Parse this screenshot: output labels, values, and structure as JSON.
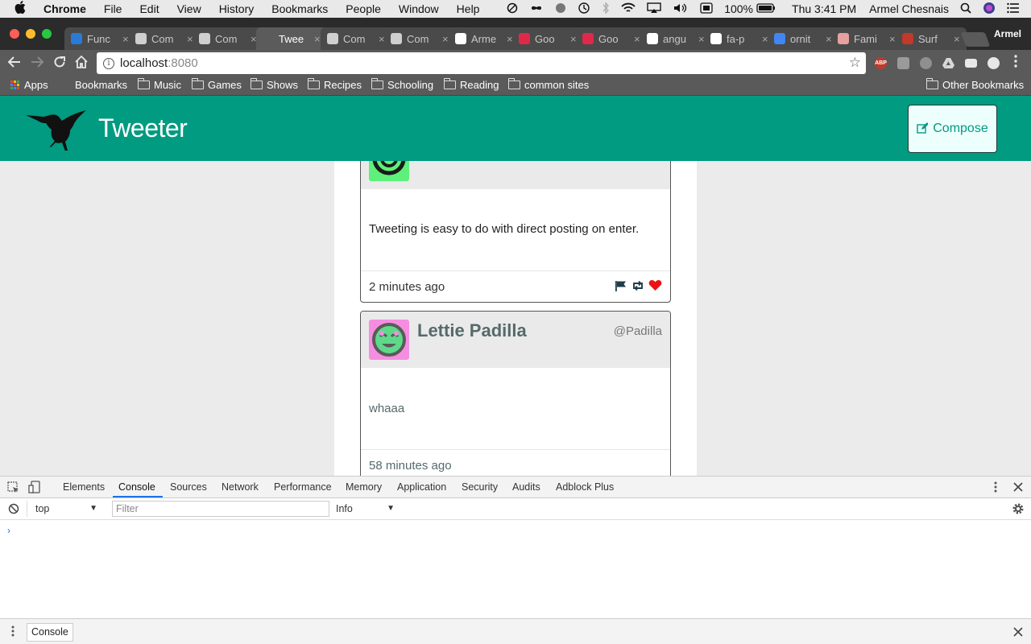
{
  "menubar": {
    "app": "Chrome",
    "items": [
      "File",
      "Edit",
      "View",
      "History",
      "Bookmarks",
      "People",
      "Window",
      "Help"
    ],
    "battery": "100%",
    "clock": "Thu 3:41 PM",
    "user": "Armel Chesnais"
  },
  "tabs": [
    {
      "label": "Func",
      "favicon": "book-icon",
      "color": "#2a7bd6"
    },
    {
      "label": "Com",
      "favicon": "globe-icon",
      "color": "#cfcfcf"
    },
    {
      "label": "Com",
      "favicon": "globe-icon",
      "color": "#cfcfcf"
    },
    {
      "label": "Twee",
      "favicon": "bird-icon",
      "color": "#5b5b5b",
      "active": true
    },
    {
      "label": "Com",
      "favicon": "globe-icon",
      "color": "#cfcfcf"
    },
    {
      "label": "Com",
      "favicon": "globe-icon",
      "color": "#cfcfcf"
    },
    {
      "label": "Arme",
      "favicon": "github-icon",
      "color": "#ffffff"
    },
    {
      "label": "Goo",
      "favicon": "m-icon",
      "color": "#e0294a"
    },
    {
      "label": "Goo",
      "favicon": "m-icon",
      "color": "#e0294a"
    },
    {
      "label": "angu",
      "favicon": "github-icon",
      "color": "#ffffff"
    },
    {
      "label": "fa-p",
      "favicon": "flag-icon",
      "color": "#ffffff"
    },
    {
      "label": "ornit",
      "favicon": "google-icon",
      "color": "#4285f4"
    },
    {
      "label": "Fami",
      "favicon": "image-icon",
      "color": "#e8a0a0"
    },
    {
      "label": "Surf",
      "favicon": "tv-icon",
      "color": "#c0392b"
    }
  ],
  "profile_name": "Armel",
  "address": {
    "host": "localhost",
    "port": ":8080"
  },
  "bookmarks": {
    "apps": "Apps",
    "items": [
      "Bookmarks",
      "Music",
      "Games",
      "Shows",
      "Recipes",
      "Schooling",
      "Reading",
      "common sites"
    ],
    "other": "Other Bookmarks"
  },
  "app": {
    "brand": "Tweeter",
    "compose_label": "Compose"
  },
  "tweets": [
    {
      "body": "Tweeting is easy to do with direct posting on enter.",
      "time": "2 minutes ago",
      "avatar_bg": "#5ef07a"
    },
    {
      "name": "Lettie Padilla",
      "handle": "@Padilla",
      "body": "whaaa",
      "time": "58 minutes ago",
      "avatar_bg": "#f58ee0"
    }
  ],
  "devtools": {
    "tabs": [
      "Elements",
      "Console",
      "Sources",
      "Network",
      "Performance",
      "Memory",
      "Application",
      "Security",
      "Audits",
      "Adblock Plus"
    ],
    "active_tab": "Console",
    "context": "top",
    "filter_placeholder": "Filter",
    "level": "Info",
    "prompt": "›",
    "drawer_tab": "Console"
  }
}
